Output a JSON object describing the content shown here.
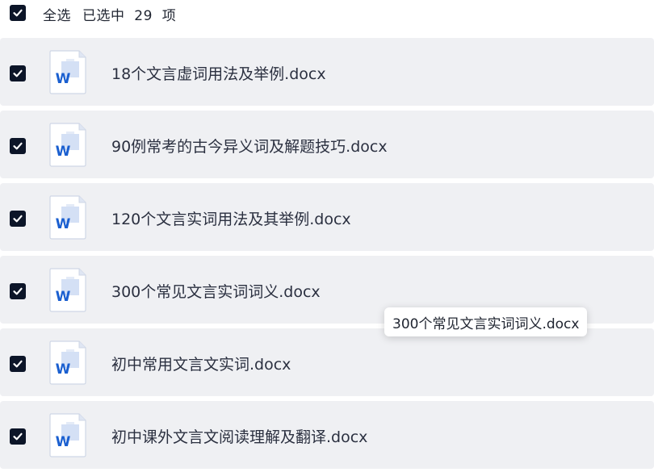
{
  "select_all": {
    "checked": true,
    "label": "全选",
    "count_text": "已选中  29  项"
  },
  "files": [
    {
      "name": "18个文言虚词用法及举例.docx",
      "checked": true,
      "icon": "word-doc-icon"
    },
    {
      "name": "90例常考的古今异义词及解题技巧.docx",
      "checked": true,
      "icon": "word-doc-icon"
    },
    {
      "name": "120个文言实词用法及其举例.docx",
      "checked": true,
      "icon": "word-doc-icon"
    },
    {
      "name": "300个常见文言实词词义.docx",
      "checked": true,
      "icon": "word-doc-icon"
    },
    {
      "name": "初中常用文言文实词.docx",
      "checked": true,
      "icon": "word-doc-icon"
    },
    {
      "name": "初中课外文言文阅读理解及翻译.docx",
      "checked": true,
      "icon": "word-doc-icon"
    }
  ],
  "tooltip": {
    "text": "300个常见文言实词词义.docx"
  },
  "colors": {
    "checkbox_fill": "#0c1528",
    "row_background": "#eff0f3",
    "word_blue": "#1a5fd0"
  }
}
